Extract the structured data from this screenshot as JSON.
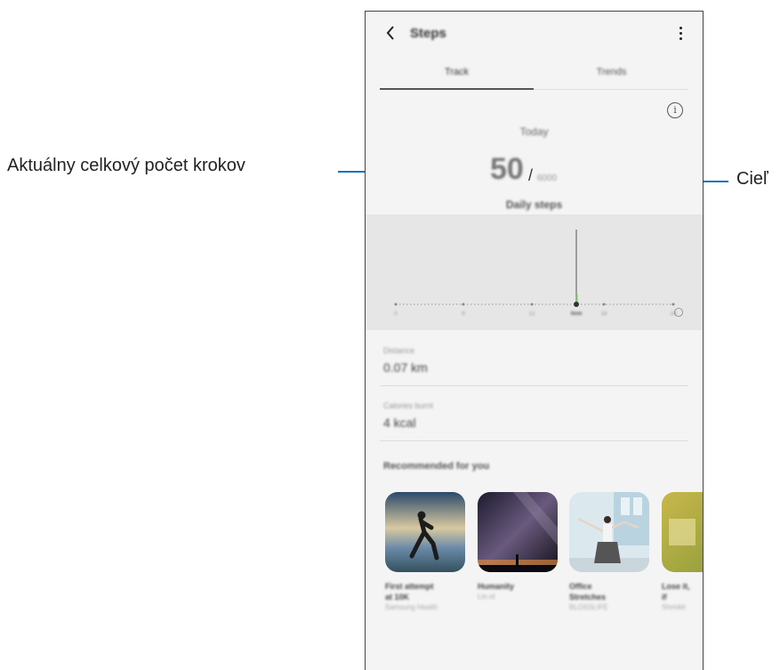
{
  "annotations": {
    "current_steps": "Aktuálny celkový počet krokov",
    "goal": "Cieľ"
  },
  "app": {
    "title": "Steps",
    "back_icon": "chevron-left-icon",
    "menu_icon": "more-vertical-icon"
  },
  "tabs": [
    {
      "label": "Track",
      "active": true
    },
    {
      "label": "Trends",
      "active": false
    }
  ],
  "summary": {
    "period": "Today",
    "current_steps": "50",
    "separator": "/",
    "goal": "6000",
    "label": "Daily steps"
  },
  "chart": {
    "tick_labels": [
      "0",
      "6",
      "12",
      "Now",
      "18",
      "24"
    ],
    "current_tick_label": "Now"
  },
  "stats": [
    {
      "label": "Distance",
      "value": "0.07 km"
    },
    {
      "label": "Calories burnt",
      "value": "4 kcal"
    }
  ],
  "recommended": {
    "title": "Recommended for you",
    "items": [
      {
        "title_line1": "First attempt",
        "title_line2": "at 10K",
        "source": "Samsung Health"
      },
      {
        "title_line1": "Humanity",
        "title_line2": "",
        "source": "Lin.ot"
      },
      {
        "title_line1": "Office",
        "title_line2": "Stretches",
        "source": "BLOSSLIFE"
      },
      {
        "title_line1": "Lose it,",
        "title_line2": "if",
        "source": "Shrinkit"
      }
    ]
  },
  "colors": {
    "callout_line": "#1a73b8",
    "goal_marker": "#7dc46b"
  }
}
